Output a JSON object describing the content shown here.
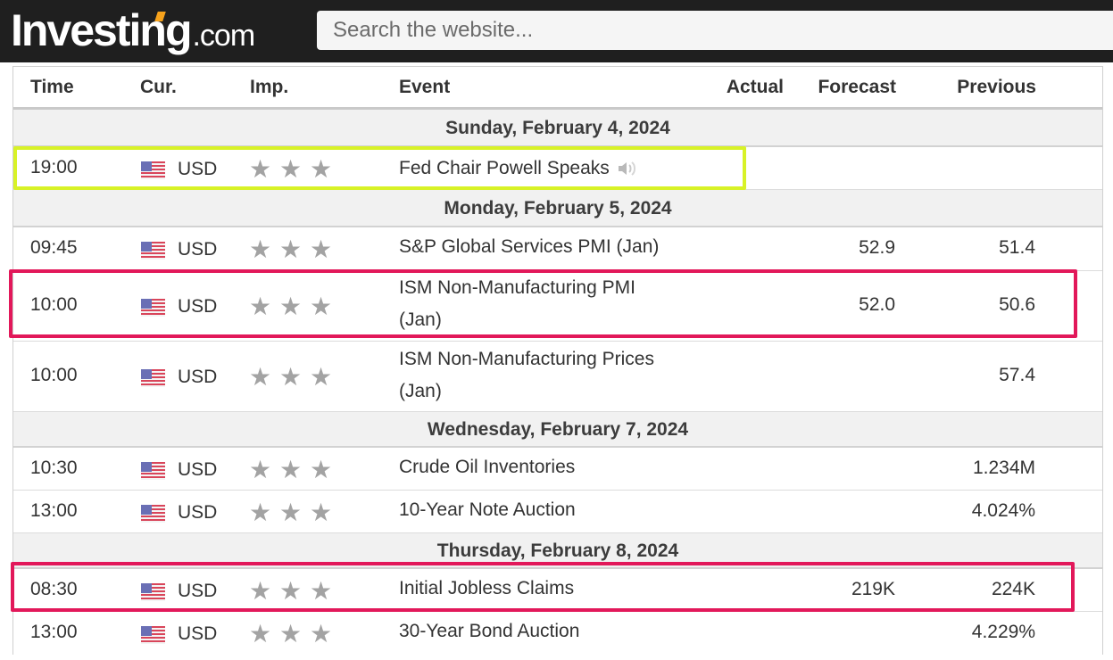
{
  "header": {
    "logo_main": "Investing",
    "logo_suffix": ".com",
    "search_placeholder": "Search the website..."
  },
  "colors": {
    "topbar": "#1f1f1f",
    "logo_accent": "#f7a21b",
    "highlight_yellow": "#d8f227",
    "highlight_pink": "#e2185a",
    "star_gray": "#a3a3a3"
  },
  "table": {
    "columns": {
      "time": "Time",
      "currency": "Cur.",
      "importance": "Imp.",
      "event": "Event",
      "actual": "Actual",
      "forecast": "Forecast",
      "previous": "Previous"
    },
    "days": [
      {
        "date": "Sunday, February 4, 2024",
        "events": [
          {
            "time": "19:00",
            "currency": "USD",
            "flag_icon": "us-flag-icon",
            "importance": 3,
            "event": "Fed Chair Powell Speaks",
            "speech_icon": "speaker-icon",
            "actual": "",
            "forecast": "",
            "previous": "",
            "highlight": "yellow"
          }
        ]
      },
      {
        "date": "Monday, February 5, 2024",
        "events": [
          {
            "time": "09:45",
            "currency": "USD",
            "flag_icon": "us-flag-icon",
            "importance": 3,
            "event": "S&P Global Services PMI (Jan)",
            "actual": "",
            "forecast": "52.9",
            "previous": "51.4",
            "highlight": ""
          },
          {
            "time": "10:00",
            "currency": "USD",
            "flag_icon": "us-flag-icon",
            "importance": 3,
            "event_line1": "ISM Non-Manufacturing PMI",
            "event_line2": "(Jan)",
            "actual": "",
            "forecast": "52.0",
            "previous": "50.6",
            "highlight": "pink"
          },
          {
            "time": "10:00",
            "currency": "USD",
            "flag_icon": "us-flag-icon",
            "importance": 3,
            "event_line1": "ISM Non-Manufacturing Prices",
            "event_line2": "(Jan)",
            "actual": "",
            "forecast": "",
            "previous": "57.4",
            "highlight": ""
          }
        ]
      },
      {
        "date": "Wednesday, February 7, 2024",
        "events": [
          {
            "time": "10:30",
            "currency": "USD",
            "flag_icon": "us-flag-icon",
            "importance": 3,
            "event": "Crude Oil Inventories",
            "actual": "",
            "forecast": "",
            "previous": "1.234M",
            "highlight": ""
          },
          {
            "time": "13:00",
            "currency": "USD",
            "flag_icon": "us-flag-icon",
            "importance": 3,
            "event": "10-Year Note Auction",
            "actual": "",
            "forecast": "",
            "previous": "4.024%",
            "highlight": ""
          }
        ]
      },
      {
        "date": "Thursday, February 8, 2024",
        "events": [
          {
            "time": "08:30",
            "currency": "USD",
            "flag_icon": "us-flag-icon",
            "importance": 3,
            "event": "Initial Jobless Claims",
            "actual": "",
            "forecast": "219K",
            "previous": "224K",
            "highlight": "pink"
          },
          {
            "time": "13:00",
            "currency": "USD",
            "flag_icon": "us-flag-icon",
            "importance": 3,
            "event": "30-Year Bond Auction",
            "actual": "",
            "forecast": "",
            "previous": "4.229%",
            "highlight": ""
          }
        ]
      }
    ]
  }
}
